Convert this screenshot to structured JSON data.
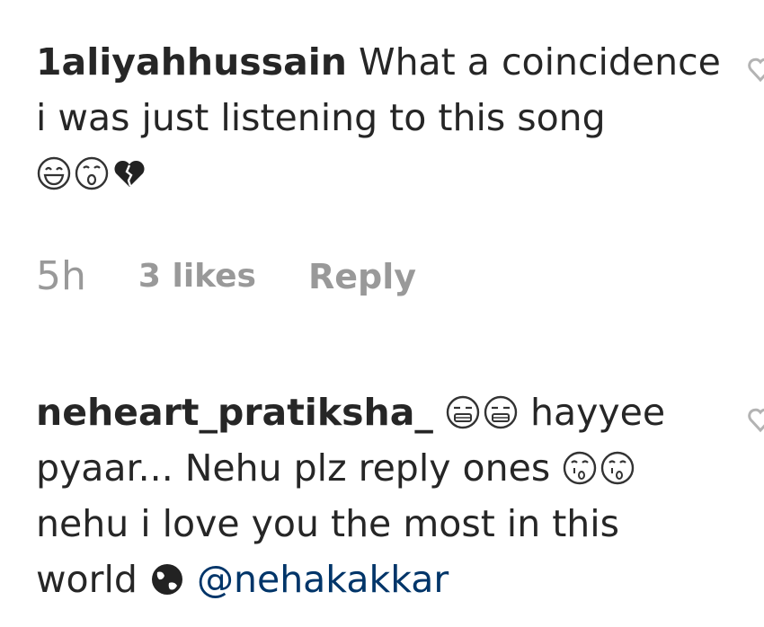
{
  "comments": [
    {
      "username": "1aliyahhussain",
      "text": "What a coincidence i was just listening to this song",
      "emojis": [
        "laughing-emoji",
        "surprised-emoji",
        "broken-heart-emoji"
      ],
      "time": "5h",
      "likes": "3 likes",
      "reply_label": "Reply"
    },
    {
      "username": "neheart_pratiksha_",
      "text_1": "hayyee pyaar... Nehu plz reply ones",
      "text_2": "nehu i love you the most in this world",
      "mention": "@nehakakkar",
      "emojis_1": [
        "grinning-sweat-emoji",
        "grinning-sweat-emoji"
      ],
      "emojis_2": [
        "kissing-emoji",
        "kissing-emoji"
      ],
      "emojis_3": [
        "earth-globe-emoji"
      ]
    }
  ],
  "colors": {
    "text": "#262626",
    "muted": "#999999",
    "mention": "#003569"
  }
}
